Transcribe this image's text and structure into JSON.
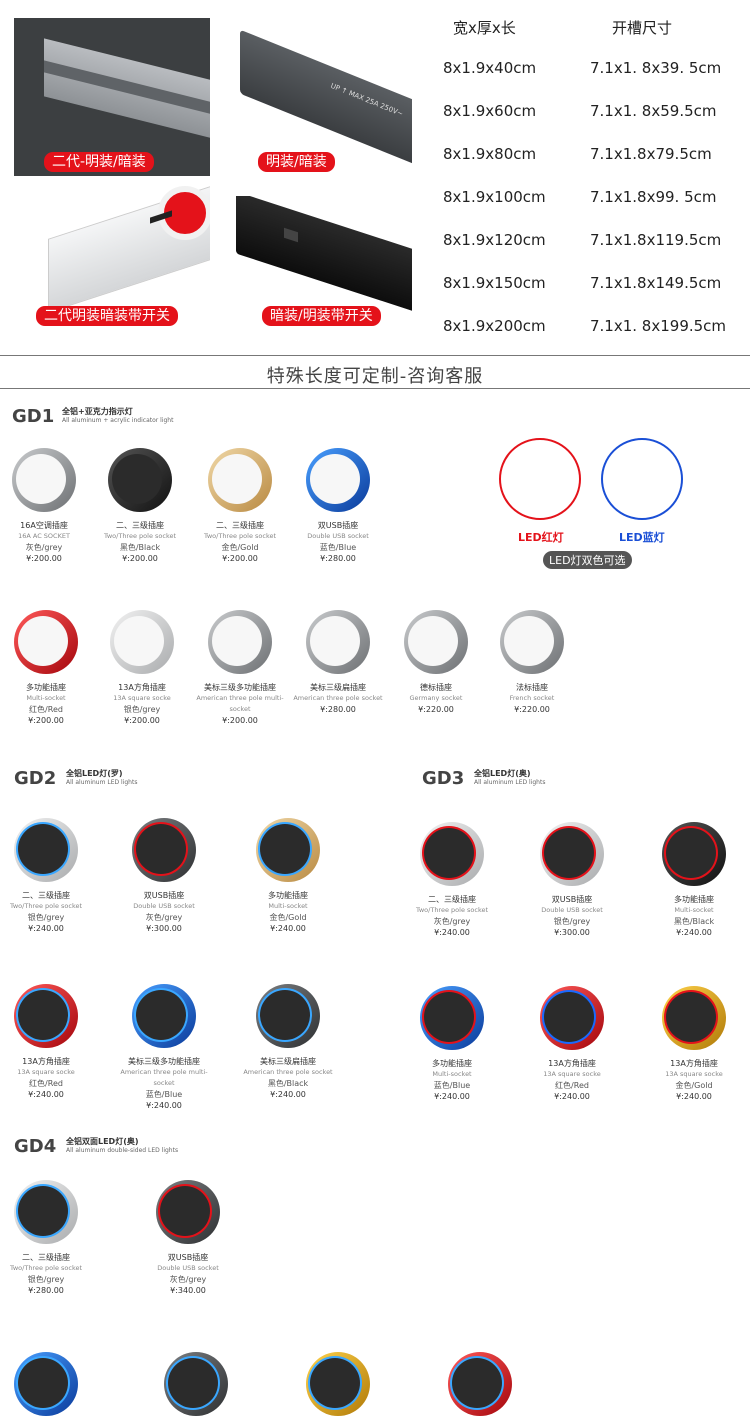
{
  "header": {
    "tags": [
      "二代-明装/暗装",
      "明装/暗装",
      "二代明装暗装带开关",
      "暗装/明装带开关"
    ],
    "track2_print": "UP ↑ MAX 25A 250V~",
    "dimensions": {
      "col1_header": "宽x厚x长",
      "col2_header": "开槽尺寸",
      "rows": [
        [
          "8x1.9x40cm",
          "7.1x1. 8x39. 5cm"
        ],
        [
          "8x1.9x60cm",
          "7.1x1. 8x59.5cm"
        ],
        [
          "8x1.9x80cm",
          "7.1x1.8x79.5cm"
        ],
        [
          "8x1.9x100cm",
          "7.1x1.8x99. 5cm"
        ],
        [
          "8x1.9x120cm",
          "7.1x1.8x119.5cm"
        ],
        [
          "8x1.9x150cm",
          "7.1x1.8x149.5cm"
        ],
        [
          "8x1.9x200cm",
          "7.1x1. 8x199.5cm"
        ]
      ]
    },
    "custom_note": "特殊长度可定制-咨询客服"
  },
  "gd1": {
    "code": "GD1",
    "title_cn": "全铝+亚克力指示灯",
    "title_en": "All aluminum + acrylic indicator light",
    "products": [
      {
        "cn": "16A空调插座",
        "en": "16A AC SOCKET",
        "color": "灰色/grey",
        "price": "¥:200.00"
      },
      {
        "cn": "二、三级插座",
        "en": "Two/Three pole socket",
        "color": "黑色/Black",
        "price": "¥:200.00"
      },
      {
        "cn": "二、三级插座",
        "en": "Two/Three pole socket",
        "color": "金色/Gold",
        "price": "¥:200.00"
      },
      {
        "cn": "双USB插座",
        "en": "Double USB socket",
        "color": "蓝色/Blue",
        "price": "¥:280.00"
      },
      {
        "cn": "多功能插座",
        "en": "Multi-socket",
        "color": "红色/Red",
        "price": "¥:200.00"
      },
      {
        "cn": "13A方角插座",
        "en": "13A square socke",
        "color": "银色/grey",
        "price": "¥:200.00"
      },
      {
        "cn": "美标三级多功能插座",
        "en": "American three pole multi-socket",
        "color": "",
        "price": "¥:200.00"
      },
      {
        "cn": "美标三级扁插座",
        "en": "American three pole socket",
        "color": "",
        "price": "¥:280.00"
      },
      {
        "cn": "德标插座",
        "en": "Germany socket",
        "color": "",
        "price": "¥:220.00"
      },
      {
        "cn": "法标插座",
        "en": "French socket",
        "color": "",
        "price": "¥:220.00"
      }
    ],
    "led": {
      "red_label": "LED红灯",
      "blue_label": "LED蓝灯",
      "note": "LED灯双色可选"
    }
  },
  "gd2": {
    "code": "GD2",
    "title_cn": "全铝LED灯(罗)",
    "title_en": "All aluminum LED lights",
    "products": [
      {
        "cn": "二、三级插座",
        "en": "Two/Three pole socket",
        "color": "银色/grey",
        "price": "¥:240.00"
      },
      {
        "cn": "双USB插座",
        "en": "Double USB socket",
        "color": "灰色/grey",
        "price": "¥:300.00"
      },
      {
        "cn": "多功能插座",
        "en": "Multi-socket",
        "color": "金色/Gold",
        "price": "¥:240.00"
      },
      {
        "cn": "13A方角插座",
        "en": "13A square socke",
        "color": "红色/Red",
        "price": "¥:240.00"
      },
      {
        "cn": "美标三级多功能插座",
        "en": "American three pole multi-socket",
        "color": "蓝色/Blue",
        "price": "¥:240.00"
      },
      {
        "cn": "美标三级扁插座",
        "en": "American three pole socket",
        "color": "黑色/Black",
        "price": "¥:240.00"
      }
    ]
  },
  "gd3": {
    "code": "GD3",
    "title_cn": "全铝LED灯(奥)",
    "title_en": "All aluminum LED lights",
    "products": [
      {
        "cn": "二、三级插座",
        "en": "Two/Three pole socket",
        "color": "灰色/grey",
        "price": "¥:240.00"
      },
      {
        "cn": "双USB插座",
        "en": "Double USB socket",
        "color": "银色/grey",
        "price": "¥:300.00"
      },
      {
        "cn": "多功能插座",
        "en": "Multi-socket",
        "color": "黑色/Black",
        "price": "¥:240.00"
      },
      {
        "cn": "多功能插座",
        "en": "Multi-socket",
        "color": "蓝色/Blue",
        "price": "¥:240.00"
      },
      {
        "cn": "13A方角插座",
        "en": "13A square socke",
        "color": "红色/Red",
        "price": "¥:240.00"
      },
      {
        "cn": "13A方角插座",
        "en": "13A square socke",
        "color": "金色/Gold",
        "price": "¥:240.00"
      }
    ]
  },
  "gd4": {
    "code": "GD4",
    "title_cn": "全铝双面LED灯(奥)",
    "title_en": "All aluminum double-sided LED lights",
    "products": [
      {
        "cn": "二、三级插座",
        "en": "Two/Three pole socket",
        "color": "银色/grey",
        "price": "¥:280.00"
      },
      {
        "cn": "双USB插座",
        "en": "Double USB socket",
        "color": "灰色/grey",
        "price": "¥:340.00"
      }
    ]
  },
  "colors": {
    "tag_red": "#e4121a",
    "led_red": "#e4121a",
    "led_blue": "#1a4fd6"
  }
}
